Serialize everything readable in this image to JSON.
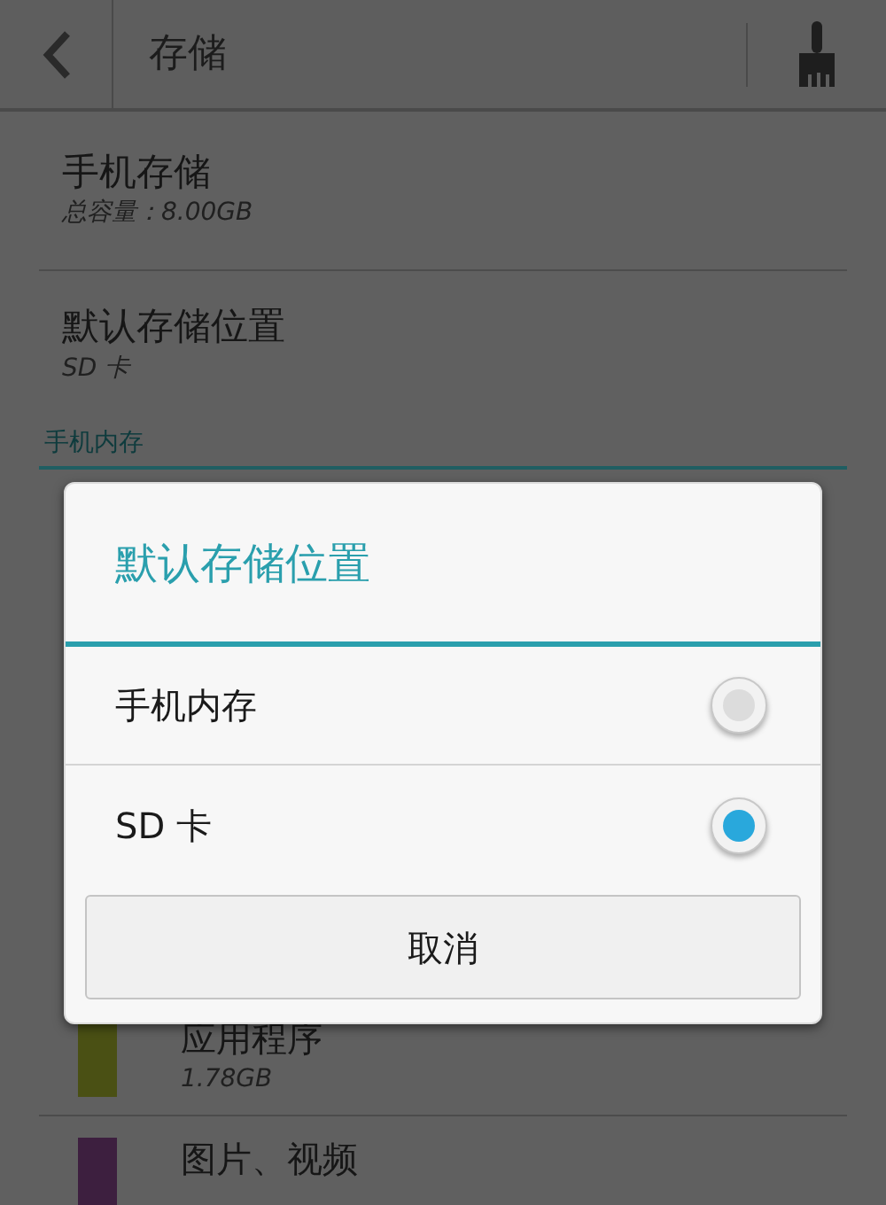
{
  "toolbar": {
    "title": "存储"
  },
  "phone_storage": {
    "title": "手机存储",
    "subtitle": "总容量：8.00GB"
  },
  "default_location": {
    "title": "默认存储位置",
    "value": "SD 卡"
  },
  "section": {
    "title": "手机内存"
  },
  "usage_rows": [
    {
      "label": "应用程序",
      "size": "1.78GB",
      "color": "#4a5014"
    },
    {
      "label": "图片、视频",
      "color": "#3d1f3f"
    }
  ],
  "dialog": {
    "title": "默认存储位置",
    "options": [
      {
        "label": "手机内存",
        "selected": false
      },
      {
        "label": "SD 卡",
        "selected": true
      }
    ],
    "cancel": "取消"
  }
}
